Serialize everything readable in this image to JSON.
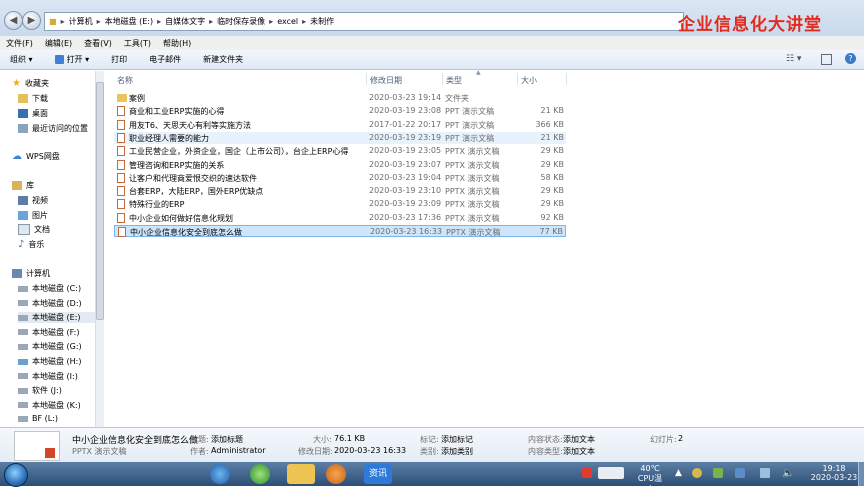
{
  "address": {
    "breadcrumbs": [
      "计算机",
      "本地磁盘 (E:)",
      "自媒体文字",
      "临时保存录像",
      "excel",
      "未制作"
    ]
  },
  "watermark": "企业信息化大讲堂",
  "menu": [
    "文件(F)",
    "编辑(E)",
    "查看(V)",
    "工具(T)",
    "帮助(H)"
  ],
  "toolbar": {
    "organize": "组织 ▾",
    "open": "打开 ▾",
    "print": "打印",
    "email": "电子邮件",
    "new_folder": "新建文件夹"
  },
  "nav": {
    "favorites": "收藏夹",
    "downloads": "下载",
    "desktop": "桌面",
    "recent": "最近访问的位置",
    "wps": "WPS网盘",
    "libraries": "库",
    "videos": "视频",
    "pictures": "图片",
    "documents": "文档",
    "music": "音乐",
    "computer": "计算机",
    "drives": [
      "本地磁盘 (C:)",
      "本地磁盘 (D:)",
      "本地磁盘 (E:)",
      "本地磁盘 (F:)",
      "本地磁盘 (G:)",
      "本地磁盘 (H:)",
      "本地磁盘 (I:)",
      "软件 (J:)",
      "本地磁盘 (K:)",
      "BF (L:)"
    ]
  },
  "columns": {
    "name": "名称",
    "date": "修改日期",
    "type": "类型",
    "size": "大小"
  },
  "files": [
    {
      "name": "案例",
      "date": "2020-03-23 19:14",
      "type": "文件夹",
      "size": ""
    },
    {
      "name": "商业和工业ERP实施的心得",
      "date": "2020-03-19 23:08",
      "type": "PPT 演示文稿",
      "size": "21 KB"
    },
    {
      "name": "用友T6、天思天心有利等实施方法",
      "date": "2017-01-22 20:17",
      "type": "PPT 演示文稿",
      "size": "366 KB"
    },
    {
      "name": "职业经理人需要的能力",
      "date": "2020-03-19 23:19",
      "type": "PPT 演示文稿",
      "size": "21 KB"
    },
    {
      "name": "工业民营企业，外资企业，国企（上市公司），台企上ERP心得",
      "date": "2020-03-19 23:05",
      "type": "PPTX 演示文稿",
      "size": "29 KB"
    },
    {
      "name": "管理咨询和ERP实施的关系",
      "date": "2020-03-19 23:07",
      "type": "PPTX 演示文稿",
      "size": "29 KB"
    },
    {
      "name": "让客户和代理商爱恨交织的速达软件",
      "date": "2020-03-23 19:04",
      "type": "PPTX 演示文稿",
      "size": "58 KB"
    },
    {
      "name": "台套ERP，大陆ERP，国外ERP优缺点",
      "date": "2020-03-19 23:10",
      "type": "PPTX 演示文稿",
      "size": "29 KB"
    },
    {
      "name": "特殊行业的ERP",
      "date": "2020-03-19 23:09",
      "type": "PPTX 演示文稿",
      "size": "29 KB"
    },
    {
      "name": "中小企业如何做好信息化规划",
      "date": "2020-03-23 17:36",
      "type": "PPTX 演示文稿",
      "size": "92 KB"
    },
    {
      "name": "中小企业信息化安全到底怎么做",
      "date": "2020-03-23 16:33",
      "type": "PPTX 演示文稿",
      "size": "77 KB"
    }
  ],
  "details": {
    "filename": "中小企业信息化安全到底怎么做",
    "filetype": "PPTX 演示文稿",
    "title_label": "标题:",
    "title_value": "添加标题",
    "author_label": "作者:",
    "author_value": "Administrator",
    "size_label": "大小:",
    "size_value": "76.1 KB",
    "modified_label": "修改日期:",
    "modified_value": "2020-03-23 16:33",
    "tags_label": "标记:",
    "tags_value": "添加标记",
    "category_label": "类别:",
    "category_value": "添加类别",
    "status_label": "内容状态:",
    "status_value": "添加文本",
    "ctype_label": "内容类型:",
    "ctype_value": "添加文本",
    "slides_label": "幻灯片:",
    "slides_value": "2"
  },
  "taskbar": {
    "active_app": "资讯",
    "temp": "40℃",
    "temp_label": "CPU温度",
    "time": "19:18",
    "date": "2020-03-23"
  }
}
